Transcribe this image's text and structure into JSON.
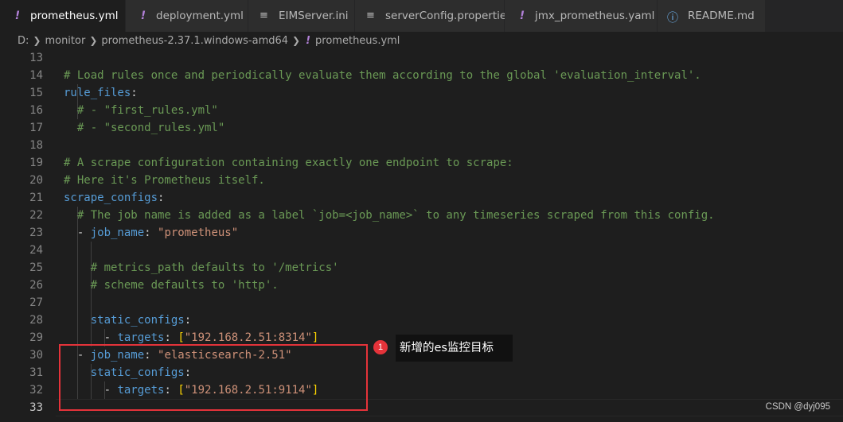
{
  "tabs": [
    {
      "label": "prometheus.yml",
      "icon": "exclamation-icon",
      "active": true,
      "close": "✕"
    },
    {
      "label": "deployment.yml",
      "icon": "exclamation-icon"
    },
    {
      "label": "EIMServer.ini",
      "icon": "lines-icon"
    },
    {
      "label": "serverConfig.properties",
      "icon": "lines-icon"
    },
    {
      "label": "jmx_prometheus.yaml",
      "icon": "exclamation-icon"
    },
    {
      "label": "README.md",
      "icon": "info-icon"
    }
  ],
  "breadcrumb": {
    "items": [
      "D:",
      "monitor",
      "prometheus-2.37.1.windows-amd64",
      "prometheus.yml"
    ]
  },
  "editor": {
    "lines": [
      {
        "n": "13",
        "parts": []
      },
      {
        "n": "14",
        "parts": [
          {
            "t": "c",
            "v": "# Load rules once and periodically evaluate them according to the global 'evaluation_interval'."
          }
        ]
      },
      {
        "n": "15",
        "parts": [
          {
            "t": "k",
            "v": "rule_files"
          },
          {
            "t": "p",
            "v": ":"
          }
        ]
      },
      {
        "n": "16",
        "parts": [
          {
            "t": "c",
            "v": "  # - \"first_rules.yml\""
          }
        ]
      },
      {
        "n": "17",
        "parts": [
          {
            "t": "c",
            "v": "  # - \"second_rules.yml\""
          }
        ]
      },
      {
        "n": "18",
        "parts": []
      },
      {
        "n": "19",
        "parts": [
          {
            "t": "c",
            "v": "# A scrape configuration containing exactly one endpoint to scrape:"
          }
        ]
      },
      {
        "n": "20",
        "parts": [
          {
            "t": "c",
            "v": "# Here it's Prometheus itself."
          }
        ]
      },
      {
        "n": "21",
        "parts": [
          {
            "t": "k",
            "v": "scrape_configs"
          },
          {
            "t": "p",
            "v": ":"
          }
        ]
      },
      {
        "n": "22",
        "parts": [
          {
            "t": "c",
            "v": "  # The job name is added as a label `job=<job_name>` to any timeseries scraped from this config."
          }
        ]
      },
      {
        "n": "23",
        "parts": [
          {
            "t": "p",
            "v": "  - "
          },
          {
            "t": "k",
            "v": "job_name"
          },
          {
            "t": "p",
            "v": ": "
          },
          {
            "t": "s",
            "v": "\"prometheus\""
          }
        ]
      },
      {
        "n": "24",
        "parts": []
      },
      {
        "n": "25",
        "parts": [
          {
            "t": "c",
            "v": "    # metrics_path defaults to '/metrics'"
          }
        ]
      },
      {
        "n": "26",
        "parts": [
          {
            "t": "c",
            "v": "    # scheme defaults to 'http'."
          }
        ]
      },
      {
        "n": "27",
        "parts": []
      },
      {
        "n": "28",
        "parts": [
          {
            "t": "p",
            "v": "    "
          },
          {
            "t": "k",
            "v": "static_configs"
          },
          {
            "t": "p",
            "v": ":"
          }
        ]
      },
      {
        "n": "29",
        "parts": [
          {
            "t": "p",
            "v": "      - "
          },
          {
            "t": "k",
            "v": "targets"
          },
          {
            "t": "p",
            "v": ": "
          },
          {
            "t": "b",
            "v": "["
          },
          {
            "t": "s",
            "v": "\"192.168.2.51:8314\""
          },
          {
            "t": "b",
            "v": "]"
          }
        ]
      },
      {
        "n": "30",
        "parts": [
          {
            "t": "p",
            "v": "  - "
          },
          {
            "t": "k",
            "v": "job_name"
          },
          {
            "t": "p",
            "v": ": "
          },
          {
            "t": "s",
            "v": "\"elasticsearch-2.51\""
          }
        ]
      },
      {
        "n": "31",
        "parts": [
          {
            "t": "p",
            "v": "    "
          },
          {
            "t": "k",
            "v": "static_configs"
          },
          {
            "t": "p",
            "v": ":"
          }
        ]
      },
      {
        "n": "32",
        "parts": [
          {
            "t": "p",
            "v": "      - "
          },
          {
            "t": "k",
            "v": "targets"
          },
          {
            "t": "p",
            "v": ": "
          },
          {
            "t": "b",
            "v": "["
          },
          {
            "t": "s",
            "v": "\"192.168.2.51:9114\""
          },
          {
            "t": "b",
            "v": "]"
          }
        ]
      },
      {
        "n": "33",
        "parts": []
      }
    ],
    "current_line": "33"
  },
  "annotation": {
    "badge": "1",
    "note": "新增的es监控目标"
  },
  "watermark": "CSDN @dyj095",
  "colors": {
    "comment": "#6a9955",
    "key": "#569cd6",
    "string": "#ce9178",
    "bracket": "#ffd700",
    "highlight_box": "#e5333a"
  }
}
